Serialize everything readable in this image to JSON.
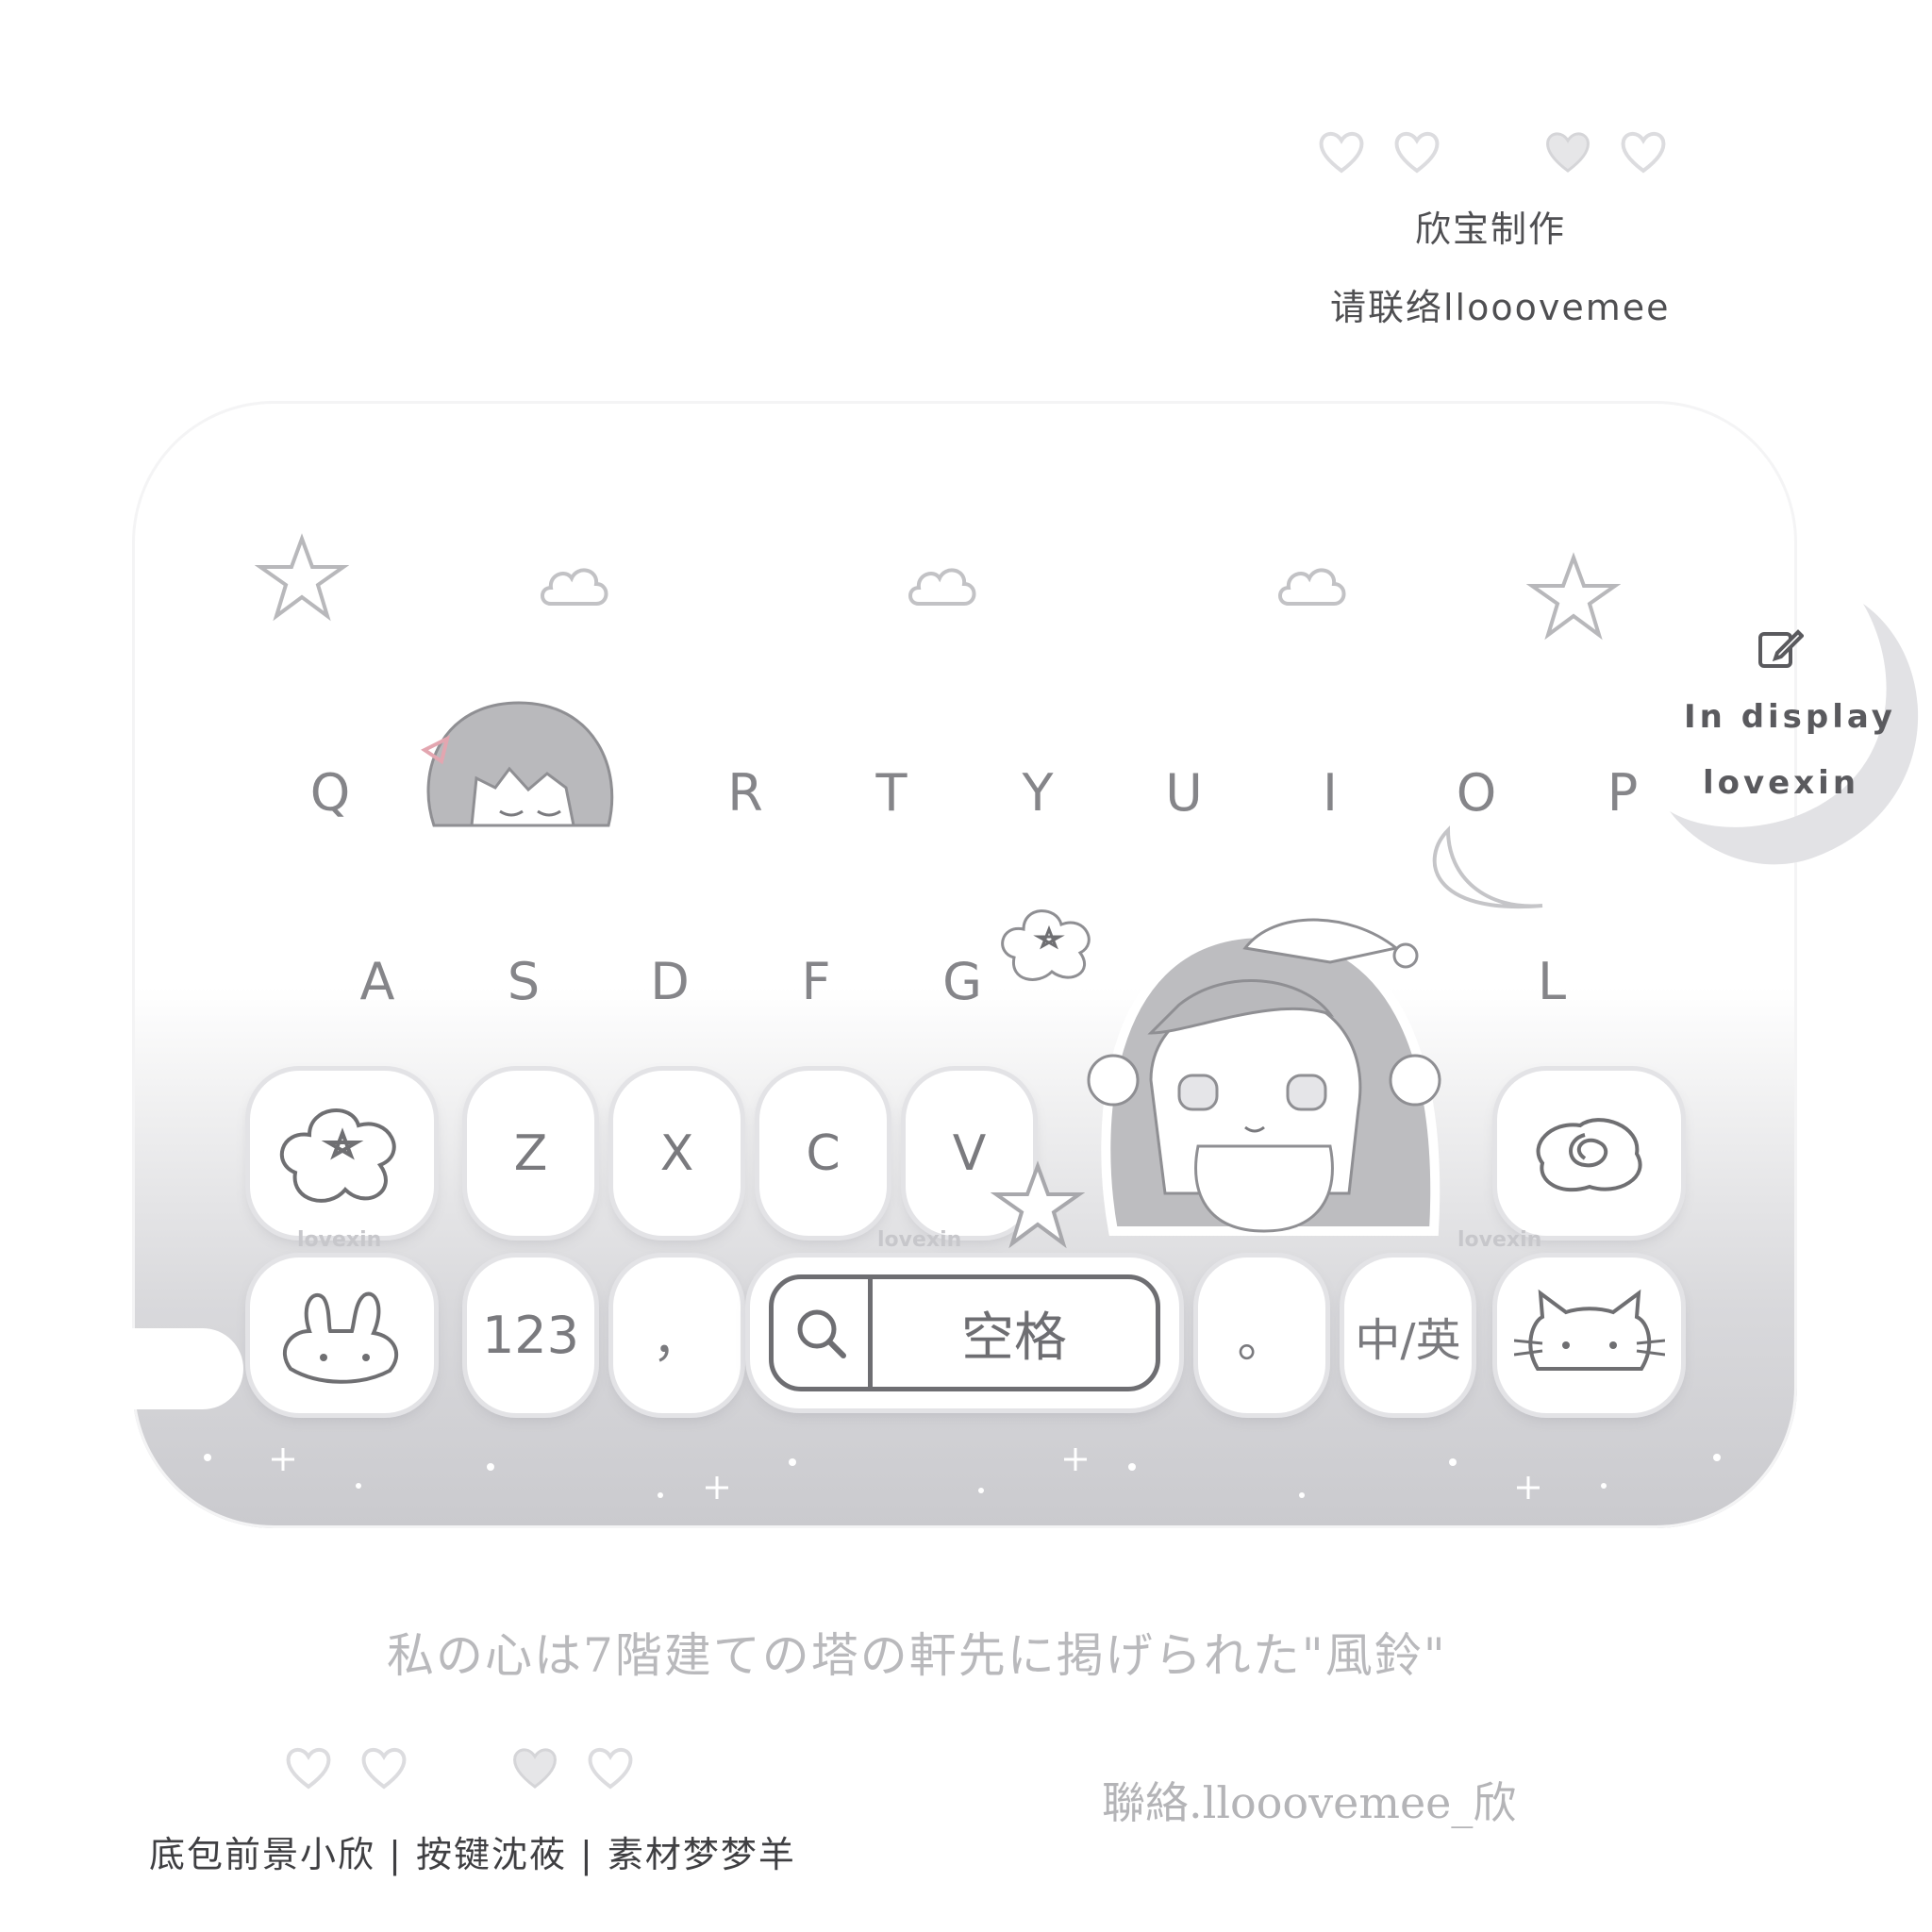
{
  "header": {
    "maker": "欣宝制作",
    "contact": "请联络llooovemee"
  },
  "keyboard": {
    "top_row": [
      "Q",
      "R",
      "T",
      "Y",
      "U",
      "I",
      "O",
      "P"
    ],
    "middle_row": [
      "A",
      "S",
      "D",
      "F",
      "G",
      "L"
    ],
    "bottom_row": [
      "Z",
      "X",
      "C",
      "V"
    ],
    "function_row": {
      "numbers": "123",
      "comma": "，",
      "space": "空格",
      "period": "。",
      "lang_switch": "中/英"
    },
    "watermark": "lovexin"
  },
  "side_badge": {
    "line1": "In display",
    "line2": "lovexin",
    "icon": "edit-icon"
  },
  "footer": {
    "quote": "私の心は7階建ての塔の軒先に掲げられた\"風鈴\"",
    "contact": "聯絡.llooovemee_欣",
    "credits": "底包前景小欣 | 按键沈莜 | 素材梦梦羊"
  },
  "colors": {
    "accent_gray": "#6f6f72",
    "panel_gradient_end": "#cacace",
    "ribbon_pink": "#e3a6b0"
  }
}
